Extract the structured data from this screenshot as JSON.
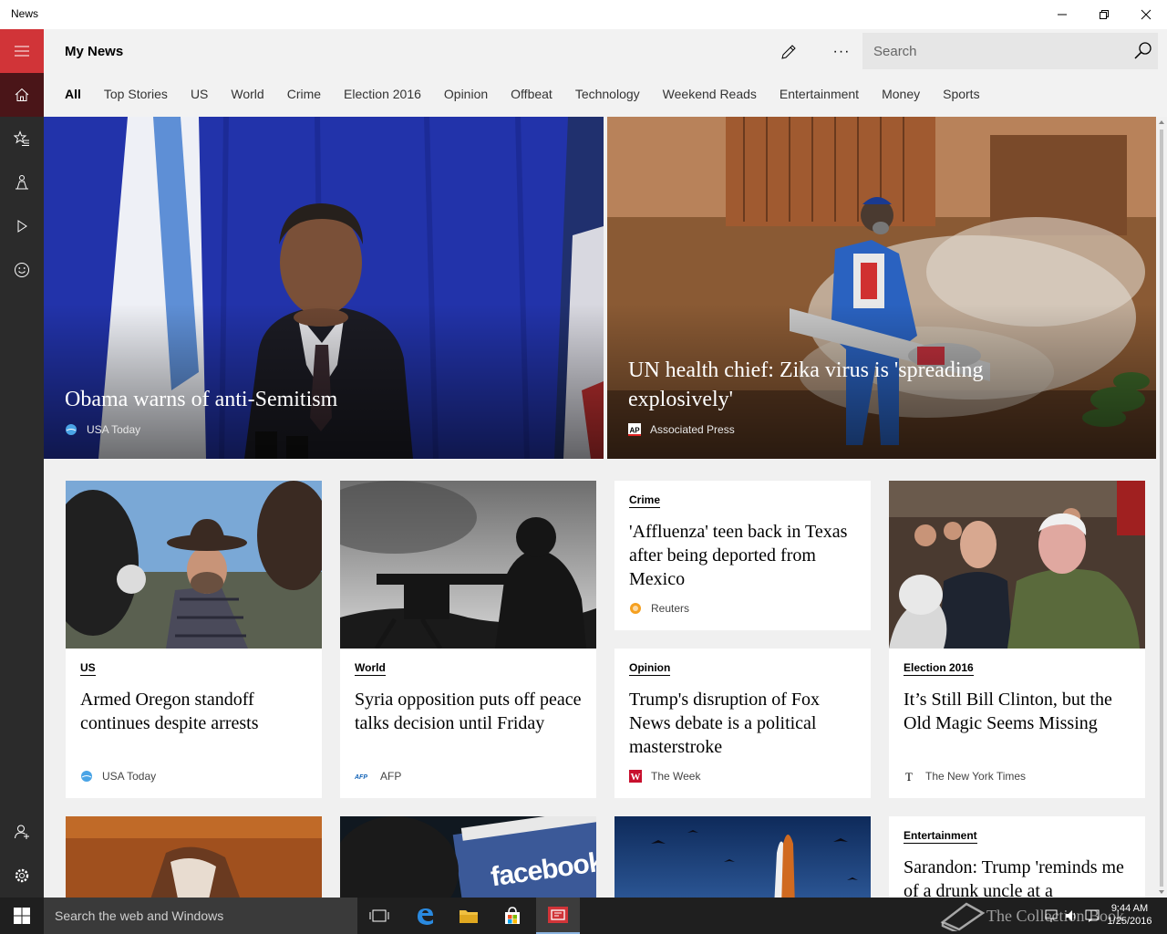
{
  "window": {
    "title": "News"
  },
  "header": {
    "page_title": "My News",
    "search_placeholder": "Search",
    "more_label": "···"
  },
  "tabs": [
    {
      "label": "All",
      "active": true
    },
    {
      "label": "Top Stories"
    },
    {
      "label": "US"
    },
    {
      "label": "World"
    },
    {
      "label": "Crime"
    },
    {
      "label": "Election 2016"
    },
    {
      "label": "Opinion"
    },
    {
      "label": "Offbeat"
    },
    {
      "label": "Technology"
    },
    {
      "label": "Weekend Reads"
    },
    {
      "label": "Entertainment"
    },
    {
      "label": "Money"
    },
    {
      "label": "Sports"
    }
  ],
  "nav": {
    "items": [
      "hamburger-icon",
      "home-icon",
      "favorites-icon",
      "local-icon",
      "video-icon",
      "feedback-icon",
      "account-icon",
      "settings-icon"
    ],
    "accent_color": "#d13438"
  },
  "hero": [
    {
      "title": "Obama warns of anti-Semitism",
      "source": "USA Today"
    },
    {
      "title": "UN health chief: Zika virus is 'spreading explosively'",
      "source": "Associated Press"
    }
  ],
  "cards": [
    {
      "category": "US",
      "headline": "Armed Oregon standoff continues despite arrests",
      "source": "USA Today"
    },
    {
      "category": "World",
      "headline": "Syria opposition puts off peace talks decision until Friday",
      "source": "AFP"
    },
    {
      "category": "Crime",
      "headline": "'Affluenza' teen back in Texas after being deported from Mexico",
      "source": "Reuters"
    },
    {
      "category": "Opinion",
      "headline": "Trump's disruption of Fox News debate is a political masterstroke",
      "source": "The Week"
    },
    {
      "category": "Election 2016",
      "headline": "It’s Still Bill Clinton, but the Old Magic Seems Missing",
      "source": "The New York Times"
    },
    {
      "category": "Entertainment",
      "headline": "Sarandon: Trump 'reminds me of a drunk uncle at a"
    }
  ],
  "images": {
    "facebook_text": "facebook"
  },
  "taskbar": {
    "search_placeholder": "Search the web and Windows",
    "time": "9:44 AM",
    "date": "1/25/2016",
    "watermark": "The Collection Book"
  }
}
